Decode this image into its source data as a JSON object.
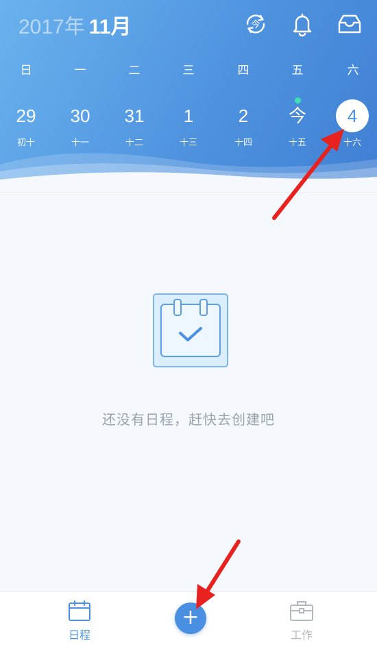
{
  "header": {
    "year": "2017年",
    "month": "11月"
  },
  "toolbar": {
    "today_icon": "today-cycle-icon",
    "bell_icon": "bell-icon",
    "inbox_icon": "inbox-icon"
  },
  "weekdays": [
    "日",
    "一",
    "二",
    "三",
    "四",
    "五",
    "六"
  ],
  "dates": [
    {
      "num": "29",
      "lunar": "初十"
    },
    {
      "num": "30",
      "lunar": "十一"
    },
    {
      "num": "31",
      "lunar": "十二"
    },
    {
      "num": "1",
      "lunar": "十三"
    },
    {
      "num": "2",
      "lunar": "十四"
    },
    {
      "num": "今",
      "lunar": "十五"
    },
    {
      "num": "4",
      "lunar": "十六"
    }
  ],
  "empty_state": {
    "icon": "calendar-check-icon",
    "message": "还没有日程，赶快去创建吧"
  },
  "tabbar": {
    "schedule_label": "日程",
    "add_label": "+",
    "work_label": "工作"
  },
  "colors": {
    "accent": "#4a90e2",
    "today_dot": "#3ee0b0",
    "arrow": "#e8221f"
  }
}
